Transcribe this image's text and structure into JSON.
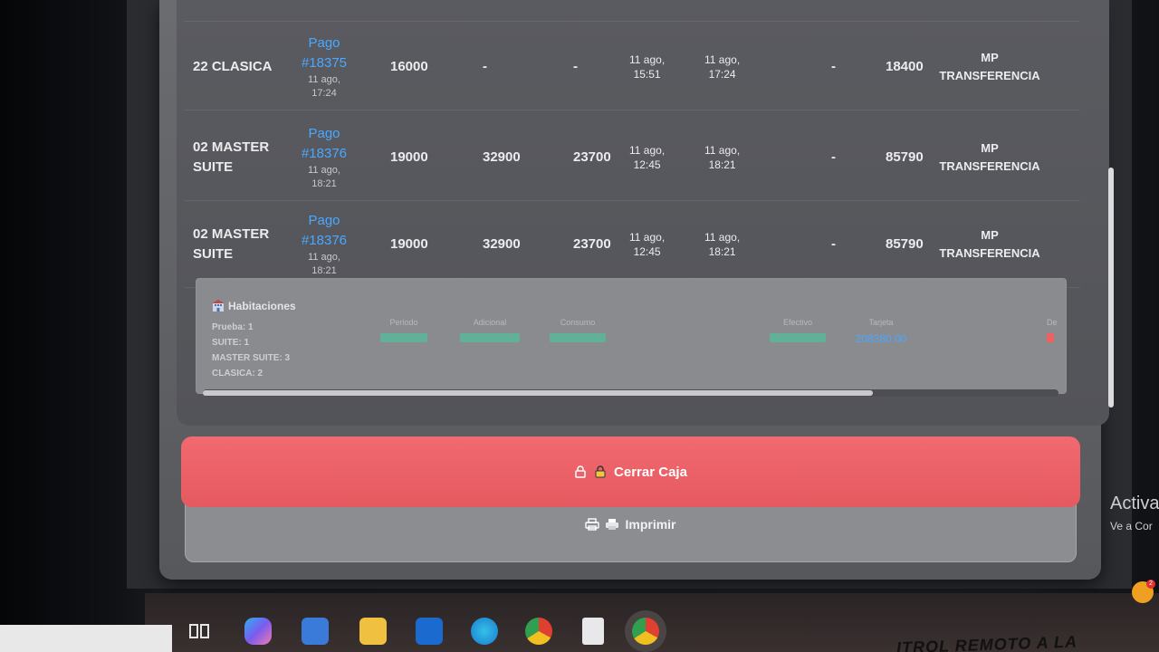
{
  "rows": [
    {
      "habitacion": [
        "22 CLASICA"
      ],
      "pago": "Pago #18375",
      "pago_fecha": [
        "11 ago,",
        "17:24"
      ],
      "v1": "16000",
      "v2": "-",
      "v3": "-",
      "entrada": [
        "11 ago,",
        "15:51"
      ],
      "salida": [
        "11 ago,",
        "17:24"
      ],
      "extra": "-",
      "total": "18400",
      "metodo": [
        "MP",
        "TRANSFERENCIA"
      ]
    },
    {
      "habitacion": [
        "02 MASTER",
        "SUITE"
      ],
      "pago": "Pago #18376",
      "pago_fecha": [
        "11 ago,",
        "18:21"
      ],
      "v1": "19000",
      "v2": "32900",
      "v3": "23700",
      "entrada": [
        "11 ago,",
        "12:45"
      ],
      "salida": [
        "11 ago,",
        "18:21"
      ],
      "extra": "-",
      "total": "85790",
      "metodo": [
        "MP",
        "TRANSFERENCIA"
      ]
    },
    {
      "habitacion": [
        "02 MASTER",
        "SUITE"
      ],
      "pago": "Pago #18376",
      "pago_fecha": [
        "11 ago,",
        "18:21"
      ],
      "v1": "19000",
      "v2": "32900",
      "v3": "23700",
      "entrada": [
        "11 ago,",
        "12:45"
      ],
      "salida": [
        "11 ago,",
        "18:21"
      ],
      "extra": "-",
      "total": "85790",
      "metodo": [
        "MP",
        "TRANSFERENCIA"
      ]
    }
  ],
  "summary": {
    "title": "Habitaciones",
    "list": [
      "Prueba: 1",
      "SUITE: 1",
      "MASTER SUITE: 3",
      "CLASICA: 2"
    ],
    "stats": [
      {
        "label": "Periodo",
        "value": "",
        "color": "#3fd0a0"
      },
      {
        "label": "Adicional",
        "value": "",
        "color": "#3fd0a0"
      },
      {
        "label": "Consumo",
        "value": "",
        "color": "#3fd0a0"
      },
      {
        "label": "Efectivo",
        "value": "",
        "color": "#3fd0a0"
      },
      {
        "label": "Tarjeta",
        "value": "208380.00",
        "color": "#4aa8ff"
      },
      {
        "label": "De",
        "value": "",
        "color": "#f06060"
      }
    ]
  },
  "buttons": {
    "close_label": "Cerrar Caja",
    "print_label": "Imprimir"
  },
  "watermark": {
    "line1": "Activa",
    "line2": "Ve a Cor"
  },
  "footer_text": "ITROL REMOTO A LA",
  "notification_count": "2",
  "colors": {
    "accent_red": "#e5595f",
    "link_blue": "#4aa8ff",
    "value_green": "#3fd0a0"
  }
}
